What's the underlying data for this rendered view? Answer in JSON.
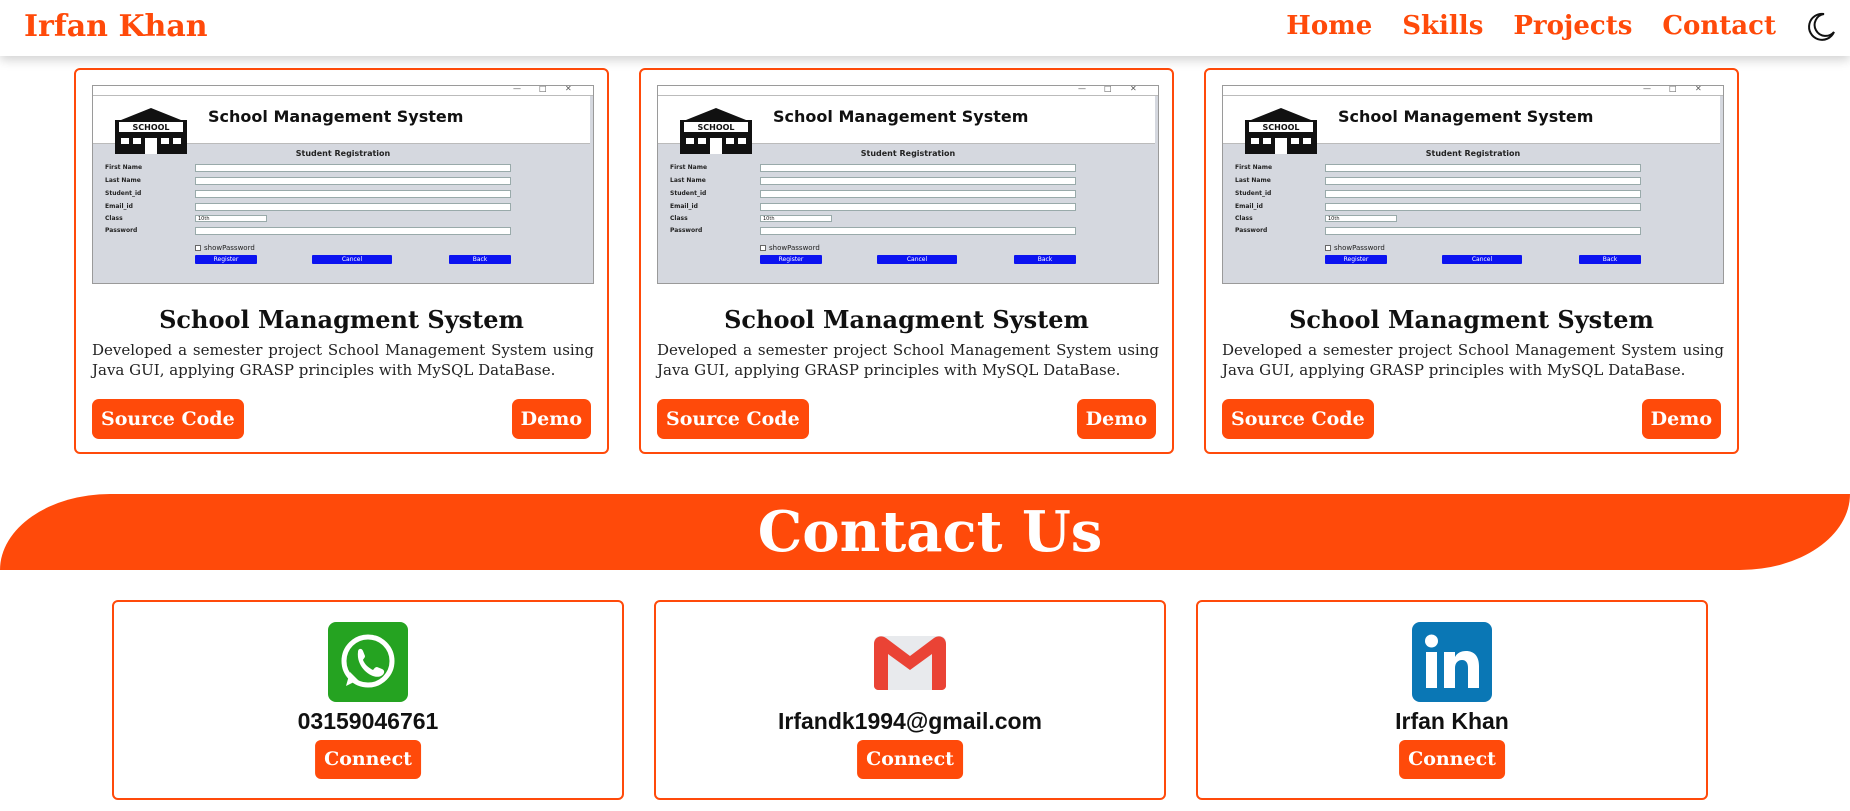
{
  "brand": "Irfan Khan",
  "nav": {
    "items": [
      "Home",
      "Skills",
      "Projects",
      "Contact"
    ],
    "theme_icon": "moon-icon"
  },
  "colors": {
    "accent": "#ff4a0a",
    "screenshot_button": "#0c13f0"
  },
  "projects": [
    {
      "title": "School Managment System",
      "description": "Developed a semester project School Management System using Java GUI, applying GRASP principles with MySQL DataBase.",
      "source_label": "Source Code",
      "demo_label": "Demo",
      "screenshot": {
        "app_title": "School Management System",
        "logo_text": "SCHOOL",
        "form_title": "Student Registration",
        "fields": [
          "First Name",
          "Last Name",
          "Student_id",
          "Email_id",
          "Class",
          "Password"
        ],
        "class_value": "10th",
        "checkbox_label": "showPassword",
        "buttons": [
          "Register",
          "Cancel",
          "Back"
        ]
      }
    },
    {
      "title": "School Managment System",
      "description": "Developed a semester project School Management System using Java GUI, applying GRASP principles with MySQL DataBase.",
      "source_label": "Source Code",
      "demo_label": "Demo",
      "screenshot": {
        "app_title": "School Management System",
        "logo_text": "SCHOOL",
        "form_title": "Student Registration",
        "fields": [
          "First Name",
          "Last Name",
          "Student_id",
          "Email_id",
          "Class",
          "Password"
        ],
        "class_value": "10th",
        "checkbox_label": "showPassword",
        "buttons": [
          "Register",
          "Cancel",
          "Back"
        ]
      }
    },
    {
      "title": "School Managment System",
      "description": "Developed a semester project School Management System using Java GUI, applying GRASP principles with MySQL DataBase.",
      "source_label": "Source Code",
      "demo_label": "Demo",
      "screenshot": {
        "app_title": "School Management System",
        "logo_text": "SCHOOL",
        "form_title": "Student Registration",
        "fields": [
          "First Name",
          "Last Name",
          "Student_id",
          "Email_id",
          "Class",
          "Password"
        ],
        "class_value": "10th",
        "checkbox_label": "showPassword",
        "buttons": [
          "Register",
          "Cancel",
          "Back"
        ]
      }
    }
  ],
  "contact": {
    "heading": "Contact Us",
    "cards": [
      {
        "icon": "whatsapp-icon",
        "value": "03159046761",
        "button": "Connect"
      },
      {
        "icon": "gmail-icon",
        "value": "Irfandk1994@gmail.com",
        "button": "Connect"
      },
      {
        "icon": "linkedin-icon",
        "value": "Irfan Khan",
        "button": "Connect"
      }
    ]
  }
}
